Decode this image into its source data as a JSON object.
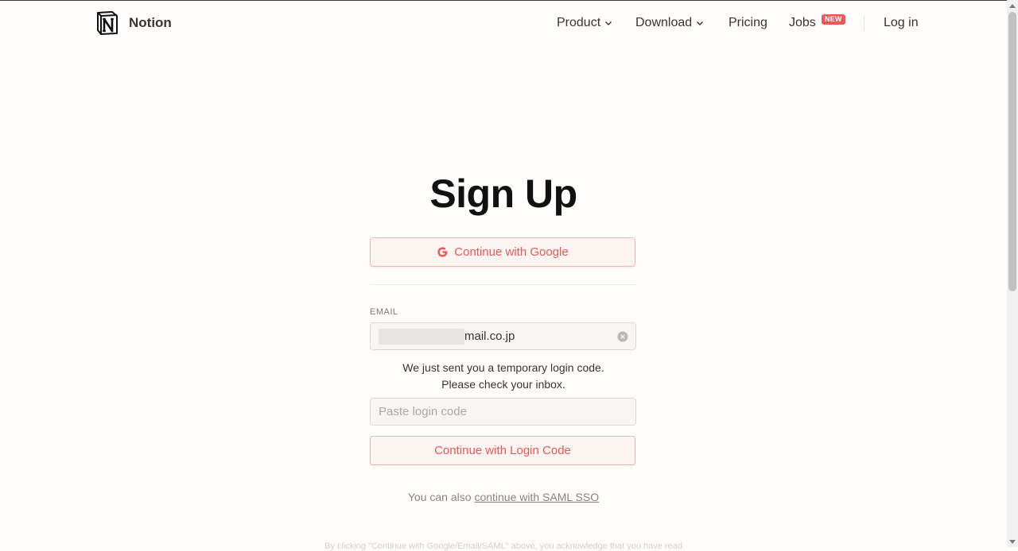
{
  "brand": {
    "name": "Notion"
  },
  "nav": {
    "product": "Product",
    "download": "Download",
    "pricing": "Pricing",
    "jobs": "Jobs",
    "jobs_badge": "NEW",
    "login": "Log in"
  },
  "main": {
    "title": "Sign Up",
    "google_button": "Continue with Google",
    "email_label": "EMAIL",
    "email_value": "mail.co.jp",
    "notice_line1": "We just sent you a temporary login code.",
    "notice_line2": "Please check your inbox.",
    "code_placeholder": "Paste login code",
    "code_button": "Continue with Login Code",
    "saml_prefix": "You can also",
    "saml_link": "continue with SAML SSO"
  },
  "footer": {
    "text": "By clicking \"Continue with Google/Email/SAML\" above, you acknowledge that you have read"
  },
  "colors": {
    "accent": "#eb5757",
    "accent_bg": "#fdf5f2",
    "text": "#37352f",
    "background": "#fffefc"
  },
  "icons": [
    "notion-logo-icon",
    "chevron-down-icon",
    "google-icon",
    "clear-input-icon"
  ]
}
